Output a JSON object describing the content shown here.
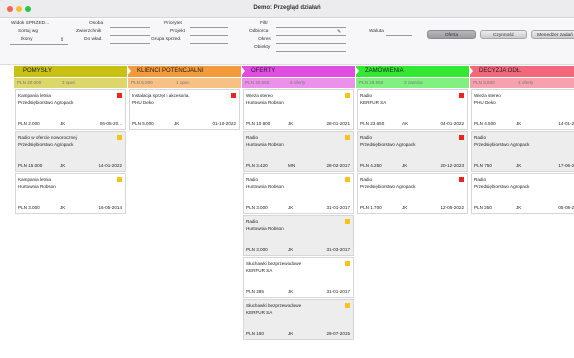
{
  "window": {
    "title": "Demo: Przegląd działań"
  },
  "filters": {
    "widok_label": "Widok SPRZED...",
    "sortuj_label": "Sortuj wg",
    "ikony_label": "Ikony",
    "ikony_arrow": "⇕",
    "osoba_label": "Osoba",
    "zwierzchnik_label": "Zwierzchnik",
    "do_wlad_label": "Do wład.",
    "priorytet_label": "Priorytet",
    "projekt_label": "Projekt",
    "grupa_label": "Grupa sprzed.",
    "filtr_label": "Filtr",
    "odbiorca_label": "Odbiorca",
    "okres_label": "Okres",
    "obiekty_label": "Obiekty",
    "waluta_label": "Waluta"
  },
  "toolbar": {
    "oferta_label": "Oferta",
    "czynnosc_label": "Czynność",
    "menedzer_label": "Menedżer zadań"
  },
  "colors": {
    "pomysly": "#c8c012",
    "klienci": "#f39a3a",
    "oferty": "#e04de0",
    "zamowienia": "#33e833",
    "decyzja": "#f2687c"
  },
  "columns": [
    {
      "name": "POMYSŁY",
      "sum_amount": "PLN 20.000",
      "sum_count": "3 oper.",
      "cards": [
        {
          "title": "Kampania letnia",
          "client": "Przedsiębiorstwo Agropack",
          "amount": "PLN 2.000",
          "owner": "JK",
          "date": "06-05-20...",
          "flag": "red",
          "alt": false
        },
        {
          "title": "Radio w ofercie noworocznej",
          "client": "Przedsiębiorstwo Agropack",
          "amount": "PLN 15.000",
          "owner": "JK",
          "date": "14-01-2022",
          "flag": "yellow",
          "alt": true
        },
        {
          "title": "Kampania letnia",
          "client": "Hurtownia Robson",
          "amount": "PLN 3.000",
          "owner": "JK",
          "date": "16-05-2014",
          "flag": "yellow",
          "alt": false
        }
      ]
    },
    {
      "name": "KLIENCI POTENCJALNI",
      "sum_amount": "PLN 5.000",
      "sum_count": "1 oper.",
      "cards": [
        {
          "title": "Instalacja sprzęt i akcesoria.",
          "client": "PHU Deko",
          "amount": "PLN 5.000",
          "owner": "JK",
          "date": "01-10-2022",
          "flag": "red",
          "alt": false
        }
      ]
    },
    {
      "name": "OFERTY",
      "sum_amount": "PLN 20.055",
      "sum_count": "6 oferty",
      "cards": [
        {
          "title": "Wieża stereo",
          "client": "Hurtownia Robson",
          "amount": "PLN 10.800",
          "owner": "JK",
          "date": "28-01-2021",
          "flag": "yellow",
          "alt": false
        },
        {
          "title": "Radio",
          "client": "Hurtownia Robson",
          "amount": "PLN 3.420",
          "owner": "MN",
          "date": "28-02-2017",
          "flag": "yellow",
          "alt": true
        },
        {
          "title": "Radio",
          "client": "Hurtownia Robson",
          "amount": "PLN 3.000",
          "owner": "JK",
          "date": "31-01-2017",
          "flag": "yellow",
          "alt": false
        },
        {
          "title": "Radio",
          "client": "Hurtownia Robson",
          "amount": "PLN 3.000",
          "owner": "JK",
          "date": "31-03-2017",
          "flag": "yellow",
          "alt": true
        },
        {
          "title": "Słuchawki bezprzewodowe",
          "client": "KERFUR SA",
          "amount": "PLN 285",
          "owner": "JK",
          "date": "31-01-2017",
          "flag": "yellow",
          "alt": false
        },
        {
          "title": "Słuchawki bezprzewodowe",
          "client": "KERFUR SA",
          "amount": "PLN 150",
          "owner": "JK",
          "date": "29-07-2015",
          "flag": "yellow",
          "alt": true
        }
      ]
    },
    {
      "name": "ZAMÓWIENIA",
      "sum_amount": "PLN 29.650",
      "sum_count": "3 zamów.",
      "cards": [
        {
          "title": "Radio",
          "client": "KERFUR SA",
          "amount": "PLN 23.650",
          "owner": "AK",
          "date": "04-01-2022",
          "flag": "red",
          "alt": false
        },
        {
          "title": "Radio",
          "client": "Przedsiębiorstwo Agropack",
          "amount": "PLN 4.250",
          "owner": "JK",
          "date": "20-12-2023",
          "flag": "red",
          "alt": true
        },
        {
          "title": "Radio",
          "client": "Przedsiębiorstwo Agropack",
          "amount": "PLN 1.700",
          "owner": "JK",
          "date": "12-05-2022",
          "flag": "red",
          "alt": false
        }
      ]
    },
    {
      "name": "DECYZJA ODŁ.",
      "sum_amount": "PLN 5.500",
      "sum_count": "3 oferty",
      "cards": [
        {
          "title": "Wieża stereo",
          "client": "PHU Deko",
          "amount": "PLN 4.500",
          "owner": "JK",
          "date": "14-01-2...",
          "flag": "",
          "alt": false
        },
        {
          "title": "Radio",
          "client": "Przedsiębiorstwo Agropack",
          "amount": "PLN 750",
          "owner": "JK",
          "date": "17-06-2...",
          "flag": "",
          "alt": true
        },
        {
          "title": "Radio",
          "client": "Przedsiębiorstwo Agropack",
          "amount": "PLN 250",
          "owner": "JK",
          "date": "05-08-2...",
          "flag": "",
          "alt": false
        }
      ]
    }
  ]
}
